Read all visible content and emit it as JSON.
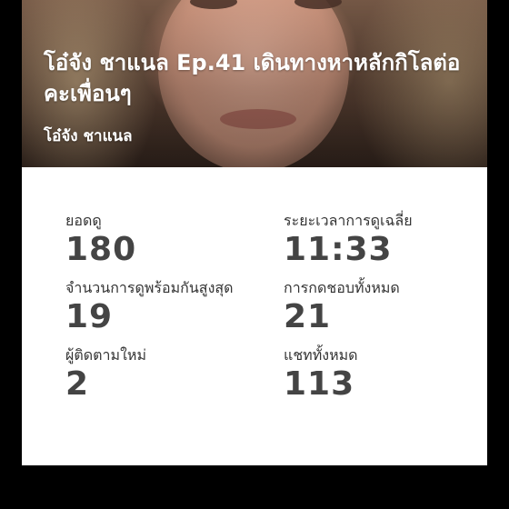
{
  "video": {
    "title": "โอ๋จัง ชาแนล Ep.41 เดินทางหาหลักกิโลต่อคะเพื่อนๆ",
    "channel": "โอ๋จัง ชาแนล"
  },
  "stats": [
    {
      "label": "ยอดดู",
      "value": "180"
    },
    {
      "label": "ระยะเวลาการดูเฉลี่ย",
      "value": "11:33"
    },
    {
      "label": "จำนวนการดูพร้อมกันสูงสุด",
      "value": "19"
    },
    {
      "label": "การกดชอบทั้งหมด",
      "value": "21"
    },
    {
      "label": "ผู้ติดตามใหม่",
      "value": "2"
    },
    {
      "label": "แชททั้งหมด",
      "value": "113"
    }
  ]
}
